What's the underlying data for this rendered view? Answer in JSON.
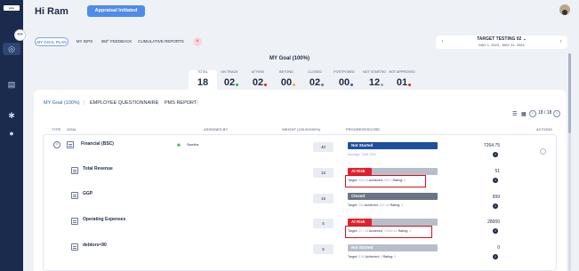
{
  "sidebar": {
    "logo_text": "pms",
    "toggle_label": "«»",
    "icons": [
      "home-icon",
      "target-icon",
      "document-icon",
      "settings-icon",
      "user-icon"
    ]
  },
  "header": {
    "greeting": "Hi Ram",
    "appraisal_button": "Appraisal Initiated"
  },
  "tabs": [
    {
      "label": "MY GOAL PLAN",
      "active": true
    },
    {
      "label": "MY IDPS",
      "active": false
    },
    {
      "label": "360° FEEDBACK",
      "active": false
    },
    {
      "label": "CUMULATIVE REPORTS",
      "active": false
    }
  ],
  "tab_close": "×",
  "period": {
    "title": "TARGET TESTING 02",
    "title_caret": "⌄",
    "dates": "MAY 1, 2024 - MAY 31, 2024",
    "prev": "‹",
    "next": "›"
  },
  "goal_summary": {
    "title": "MY Goal (100%)",
    "stats": [
      {
        "label": "TOTAL",
        "value": "18",
        "dot": ""
      },
      {
        "label": "ON TRACK",
        "value": "02",
        "dot": "#2fb344"
      },
      {
        "label": "AT RISK",
        "value": "02",
        "dot": "#e41f2b"
      },
      {
        "label": "BEYOND",
        "value": "00",
        "dot": "#f2b01e"
      },
      {
        "label": "CLOSED",
        "value": "02",
        "dot": "#6b7690"
      },
      {
        "label": "POSTPONED",
        "value": "00",
        "dot": "#2d5fb3"
      },
      {
        "label": "NOT STARTED",
        "value": "12",
        "dot": "#9aa3b5"
      },
      {
        "label": "NOT APPROVED",
        "value": "01",
        "dot": "#e41f2b"
      }
    ]
  },
  "subtabs": [
    "MY Goal (100%)",
    "EMPLOYEE QUESTIONNAIRE",
    "PMS REPORT"
  ],
  "pager": {
    "text": "18 / 18",
    "prev": "‹",
    "next": "›"
  },
  "view_icons": {
    "list": "☰",
    "grid": "▦"
  },
  "table": {
    "headers": [
      "TYPE",
      "GOAL",
      "ASSIGNED BY",
      "WEIGHT (100.00/100%)",
      "PROGRESS/SCORE",
      "ACTIONS"
    ],
    "rows": [
      {
        "name": "Financial (BSC)",
        "expand": "˅",
        "assigned_by": "Swetha",
        "weight": "40",
        "status": "Not Started",
        "status_color": "#1d4f9e",
        "red_fill": 0,
        "meta_parts": [
          "Average: ",
          "7264.75%"
        ],
        "score": "7264.75"
      },
      {
        "name": "Total Revenue",
        "weight": "15",
        "status": "At Risk",
        "status_color": "#b8bec9",
        "red_fill": 0.27,
        "meta_parts": [
          "Target: ",
          "325.25",
          " Achieved: ",
          "200.7",
          " Rating: ",
          "0"
        ],
        "score": "51",
        "highlight": true
      },
      {
        "name": "GGP",
        "weight": "15",
        "status": "Closed",
        "status_color": "#6b7485",
        "red_fill": 0,
        "meta_parts": [
          "Target: ",
          "245",
          " Achieved: ",
          "247.33",
          " Rating: ",
          "0"
        ],
        "score": "999",
        "highlight": false
      },
      {
        "name": "Operating Expenses",
        "weight": "5",
        "status": "At Risk",
        "status_color": "#b8bec9",
        "red_fill": 0.27,
        "meta_parts": [
          "Target: ",
          "27 / 25",
          " Achieved: ",
          "72552.61",
          " Rating: ",
          "0"
        ],
        "score": "28000",
        "highlight": true
      },
      {
        "name": "debtors<90",
        "weight": "5",
        "status": "Not Started",
        "status_color": "#b8bec9",
        "red_fill": 0,
        "meta_parts": [
          "Target: ",
          "0.00",
          " Achieved: ",
          "0",
          " Rating: ",
          "0"
        ],
        "score": "0",
        "highlight": false
      }
    ]
  },
  "info_glyph": "i"
}
